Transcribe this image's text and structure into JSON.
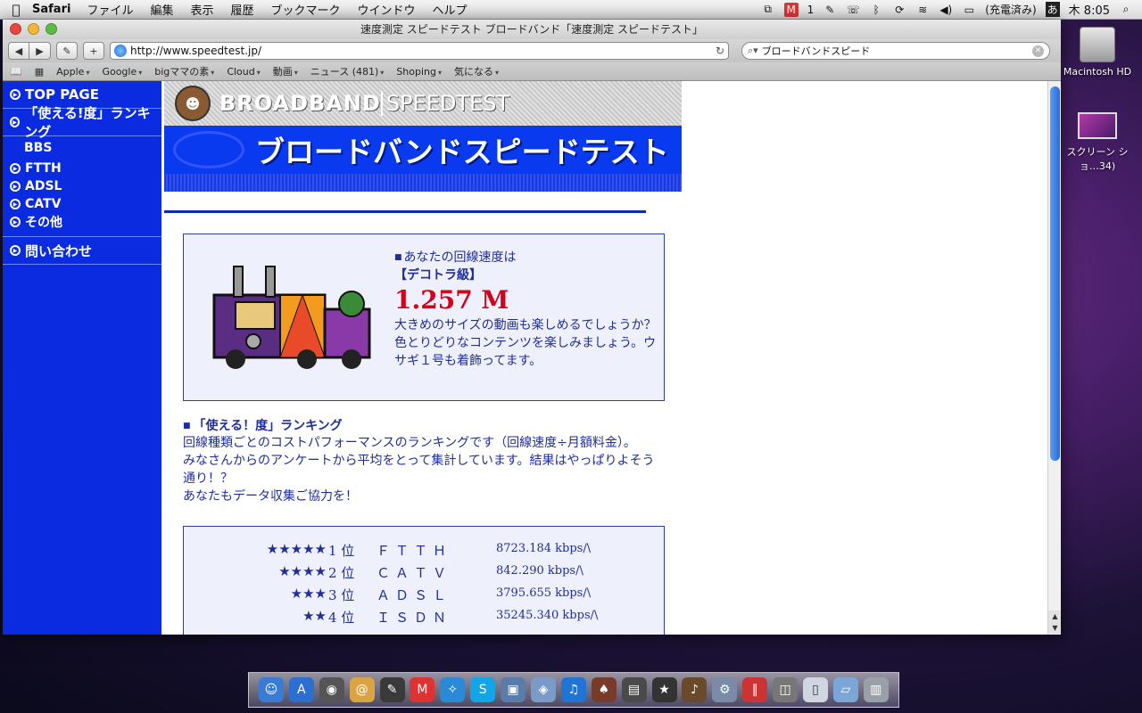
{
  "menubar": {
    "app_name": "Safari",
    "menus": [
      "ファイル",
      "編集",
      "表示",
      "履歴",
      "ブックマーク",
      "ウインドウ",
      "ヘルプ"
    ],
    "mail_count": "1",
    "battery": "(充電済み)",
    "input_method": "あ",
    "clock": "木 8:05"
  },
  "window": {
    "title": "速度測定 スピードテスト ブロードバンド「速度測定 スピードテスト」",
    "url": "http://www.speedtest.jp/",
    "search_query": "ブロードバンドスピード"
  },
  "bookmarks": [
    "Apple",
    "Google",
    "bigママの素",
    "Cloud",
    "動画",
    "ニュース (481)",
    "Shoping",
    "気になる"
  ],
  "sidenav": {
    "top_page": "TOP PAGE",
    "ranking": "「使える!度」ランキング",
    "bbs": "BBS",
    "ftth": "FTTH",
    "adsl": "ADSL",
    "catv": "CATV",
    "other": "その他",
    "contact": "問い合わせ"
  },
  "banner": {
    "broadband": "BROADBAND",
    "speedtest": "SPEEDTEST",
    "title_jp": "ブロードバンドスピードテスト"
  },
  "result": {
    "label": "あなたの回線速度は",
    "class": "【デコトラ級】",
    "speed": "1.257 M",
    "description": "大きめのサイズの動画も楽しめるでしょうか？　色とりどりなコンテンツを楽しみましょう。ウサギ１号も着飾ってます。"
  },
  "ranking": {
    "heading": "「使える！度」ランキング",
    "line1": "回線種類ごとのコストパフォーマンスのランキングです（回線速度÷月額料金）。",
    "line2": "みなさんからのアンケートから平均をとって集計しています。結果はやっぱりよそう通り！？",
    "line3": "あなたもデータ収集ご協力を！",
    "rows": [
      {
        "stars": "★★★★★",
        "rank": "1 位",
        "type": "ＦＴＴＨ",
        "value": "8723.184 kbps/\\"
      },
      {
        "stars": "★★★★",
        "rank": "2 位",
        "type": "ＣＡＴＶ",
        "value": "842.290 kbps/\\"
      },
      {
        "stars": "★★★",
        "rank": "3 位",
        "type": "ＡＤＳＬ",
        "value": "3795.655 kbps/\\"
      },
      {
        "stars": "★★",
        "rank": "4 位",
        "type": "ＩＳＤＮ",
        "value": "35245.340 kbps/\\"
      }
    ]
  },
  "desktop": {
    "hd_label": "Macintosh HD",
    "screenshot_label": "スクリーン ショ…34)"
  }
}
